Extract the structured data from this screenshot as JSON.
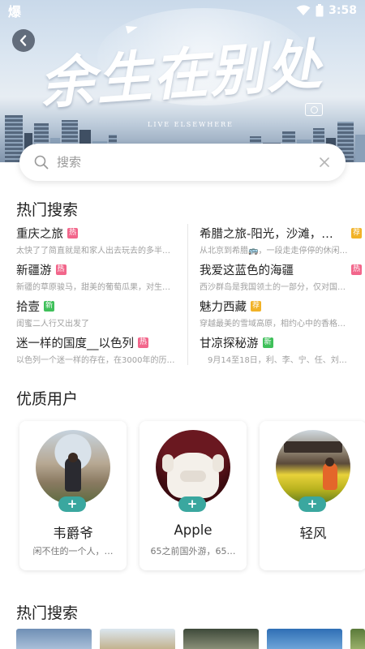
{
  "status_bar": {
    "carrier": "爆",
    "time": "3:58"
  },
  "banner": {
    "title": "余生在别处",
    "subtitle": "LIVE ELSEWHERE"
  },
  "search": {
    "placeholder": "搜索"
  },
  "hot_search": {
    "title": "热门搜索",
    "left": [
      {
        "name": "重庆之旅",
        "badge": "热",
        "badge_type": "hot",
        "desc": "太快了了简直就是和家人出去玩去的多半不…"
      },
      {
        "name": "新疆游",
        "badge": "热",
        "badge_type": "hot",
        "desc": "新疆的草原骏马，甜美的葡萄瓜果，对生活…"
      },
      {
        "name": "拾壹",
        "badge": "新",
        "badge_type": "new",
        "desc": "闺蜜二人行又出发了"
      },
      {
        "name": "迷一样的国度__以色列",
        "badge": "热",
        "badge_type": "hot",
        "desc": "以色列一个迷一样的存在，在3000年的历…"
      }
    ],
    "right": [
      {
        "name": "希腊之旅-阳光，沙滩，…",
        "badge": "荐",
        "badge_type": "rec",
        "desc": "从北京到希腊🚌，一段走走停停的休闲…"
      },
      {
        "name": "我爱这蓝色的海疆",
        "badge": "热",
        "badge_type": "hot",
        "desc": "西沙群岛是我国领土的一部分，仅对国…"
      },
      {
        "name": "魅力西藏",
        "badge": "荐",
        "badge_type": "rec",
        "desc": "穿越最美的雪域高原，相约心中的香格…"
      },
      {
        "name": "甘凉探秘游",
        "badge": "新",
        "badge_type": "new",
        "desc": "9月14至18日，利、李、宁、任、刘…"
      }
    ]
  },
  "quality_users": {
    "title": "优质用户",
    "follow_label": "+",
    "users": [
      {
        "name": "韦爵爷",
        "bio": "闲不住的一个人，…"
      },
      {
        "name": "Apple",
        "bio": "65之前国外游，65…"
      },
      {
        "name": "轻风",
        "bio": ""
      }
    ]
  },
  "hot_search_bottom": {
    "title": "热门搜索"
  },
  "colors": {
    "hot": "#f2668b",
    "new": "#3fc05a",
    "rec": "#f1b227",
    "follow": "#3aa79f"
  }
}
